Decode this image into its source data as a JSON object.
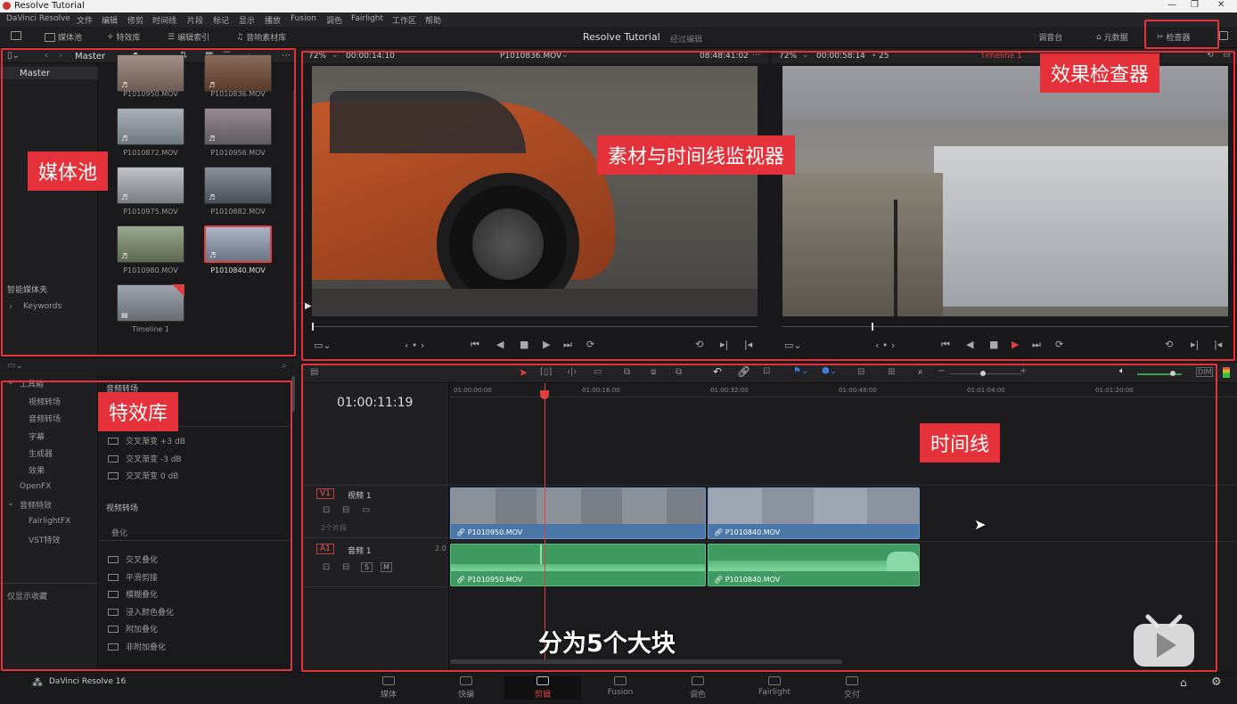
{
  "window": {
    "title": "Resolve Tutorial"
  },
  "menu": [
    "DaVinci Resolve",
    "文件",
    "编辑",
    "修剪",
    "时间线",
    "片段",
    "标记",
    "显示",
    "播放",
    "Fusion",
    "调色",
    "Fairlight",
    "工作区",
    "帮助"
  ],
  "toolbar": {
    "media_pool": "媒体池",
    "effects": "特效库",
    "edit_index": "编辑索引",
    "sound_library": "音响素材库",
    "project": "Resolve Tutorial",
    "project_status": "经过编辑",
    "mixer": "调音台",
    "metadata": "元数据",
    "inspector": "检查器"
  },
  "media_pool": {
    "bin": "Master",
    "tree_root": "Master",
    "smart_bins": "智能媒体夹",
    "keywords": "Keywords",
    "clips": [
      {
        "name": "P1010950.MOV",
        "color": "#8e7a70"
      },
      {
        "name": "P1010836.MOV",
        "color": "#7a5a4a"
      },
      {
        "name": "P1010872.MOV",
        "color": "#8a9098"
      },
      {
        "name": "P1010956.MOV",
        "color": "#7d7a80"
      },
      {
        "name": "P1010975.MOV",
        "color": "#9aa0a8"
      },
      {
        "name": "P1010882.MOV",
        "color": "#6a7078"
      },
      {
        "name": "P1010980.MOV",
        "color": "#7d8870"
      },
      {
        "name": "P1010840.MOV",
        "color": "#8c96a4"
      },
      {
        "name": "Timeline 1",
        "color": "#848890"
      }
    ]
  },
  "effects": {
    "toolbox": "工具箱",
    "tree": [
      "视频转场",
      "音频转场",
      "字幕",
      "生成器",
      "效果"
    ],
    "openfx": "OpenFX",
    "audio_fx": "音频特效",
    "fairlight_fx": "FairlightFX",
    "vst": "VST特效",
    "favorites": "仅显示收藏",
    "audio_transitions_title": "音频转场",
    "audio_transitions": [
      "交叉渐变 +3 dB",
      "交叉渐变 -3 dB",
      "交叉渐变 0 dB"
    ],
    "video_transitions_title": "视频转场",
    "dissolve": "叠化",
    "video_transitions": [
      "交叉叠化",
      "平滑剪接",
      "模糊叠化",
      "浸入颜色叠化",
      "附加叠化",
      "非附加叠化"
    ]
  },
  "source_viewer": {
    "zoom": "72%",
    "timecode": "00:00:14:10",
    "clip": "P1010836.MOV",
    "tc_right": "08:48:41:02"
  },
  "timeline_viewer": {
    "zoom": "72%",
    "timecode": "00:00:58:14",
    "fps": "25",
    "name": "Timeline 1"
  },
  "timeline": {
    "timecode": "01:00:11:19",
    "ruler": [
      "01:00:00:00",
      "01:00:16:00",
      "01:00:32:00",
      "01:00:48:00",
      "01:01:04:00",
      "01:01:20:00"
    ],
    "v1": {
      "id": "V1",
      "name": "视频 1",
      "sub": "2个片段"
    },
    "a1": {
      "id": "A1",
      "name": "音频 1",
      "ch": "2.0",
      "solo": "S",
      "mute": "M"
    },
    "clips": [
      {
        "name": "P1010950.MOV"
      },
      {
        "name": "P1010840.MOV"
      }
    ]
  },
  "pages": [
    {
      "label": "媒体"
    },
    {
      "label": "快编"
    },
    {
      "label": "剪辑"
    },
    {
      "label": "Fusion"
    },
    {
      "label": "调色"
    },
    {
      "label": "Fairlight"
    },
    {
      "label": "交付"
    }
  ],
  "app_version": "DaVinci Resolve 16",
  "annotations": {
    "media_pool": "媒体池",
    "effects_library": "特效库",
    "viewers": "素材与时间线监视器",
    "inspector": "效果检查器",
    "timeline": "时间线",
    "caption": "分为5个大块"
  },
  "colors": {
    "accent_red": "#e5323a",
    "video_clip": "#4a77a8",
    "audio_clip": "#3f9a62"
  }
}
